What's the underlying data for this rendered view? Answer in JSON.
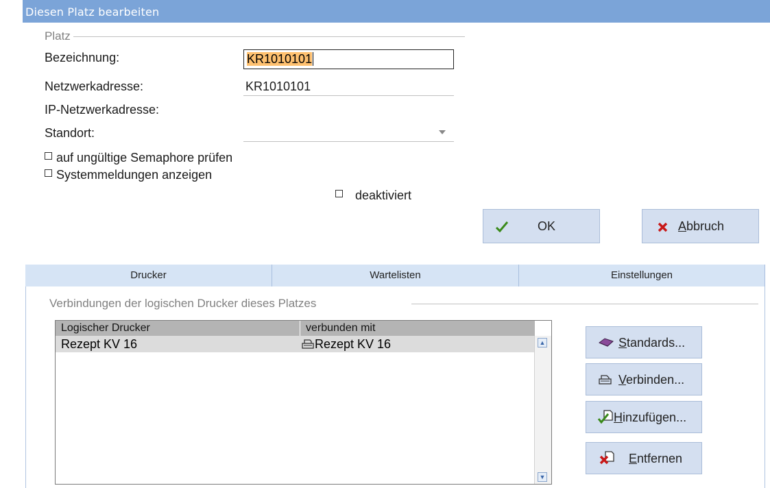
{
  "window": {
    "title": "Diesen Platz bearbeiten"
  },
  "platz_group": {
    "legend": "Platz"
  },
  "fields": {
    "bezeichnung_label": "Bezeichnung:",
    "bezeichnung_value": "KR1010101",
    "netzwerkadresse_label": "Netzwerkadresse:",
    "netzwerkadresse_value": "KR1010101",
    "ip_label": "IP-Netzwerkadresse:",
    "ip_value": "",
    "standort_label": "Standort:",
    "standort_value": ""
  },
  "checkboxes": {
    "semaphore": "auf ungültige Semaphore prüfen",
    "systemmeldungen": "Systemmeldungen anzeigen",
    "deaktiviert": "deaktiviert"
  },
  "buttons": {
    "ok": "OK",
    "abbruch_mnemonic": "A",
    "abbruch_rest": "bbruch"
  },
  "tabs": [
    {
      "label": "Drucker",
      "active": true
    },
    {
      "label": "Wartelisten",
      "active": false
    },
    {
      "label": "Einstellungen",
      "active": false
    }
  ],
  "drucker_panel": {
    "group_legend": "Verbindungen der logischen Drucker dieses Platzes",
    "columns": [
      "Logischer Drucker",
      "verbunden mit"
    ],
    "rows": [
      {
        "logischer_drucker": "Rezept KV 16",
        "verbunden_mit": "Rezept KV 16"
      }
    ]
  },
  "side_buttons": {
    "standards_mnemonic": "S",
    "standards_rest": "tandards...",
    "verbinden_mnemonic": "V",
    "verbinden_rest": "erbinden...",
    "hinzufuegen_mnemonic": "H",
    "hinzufuegen_rest": "inzufügen...",
    "entfernen_mnemonic": "E",
    "entfernen_rest": "ntfernen"
  },
  "colors": {
    "titlebar": "#7ba4d8",
    "button_bg": "#d4dff0",
    "tab_bg": "#d6e4f5",
    "selection": "#ffc170",
    "ok_check": "#3a8a1a",
    "cancel_x": "#c81818"
  }
}
